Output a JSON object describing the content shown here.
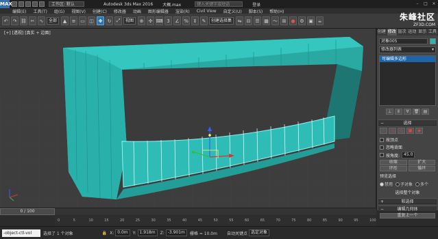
{
  "titlebar": {
    "logo": "MAX",
    "workspace": "工作区: 默认",
    "app_title": "Autodesk 3ds Max 2016",
    "file_name": "大概.max",
    "search_placeholder": "键入关键字或短语",
    "signin": "登录"
  },
  "menubar": [
    "编辑(E)",
    "工具(T)",
    "组(G)",
    "视图(V)",
    "创建(C)",
    "修改器",
    "动画",
    "图形编辑器",
    "渲染(R)",
    "Civil View",
    "自定义(U)",
    "脚本(S)",
    "帮助(H)"
  ],
  "toolbar": {
    "selection_filter": "全部",
    "reference_coord": "视图",
    "named_selection": "创建选择集"
  },
  "watermark": {
    "mark": "朱峰社区",
    "sub": "ZF3D.COM"
  },
  "viewport": {
    "label": "[+] [透视] [真实 + 边面]"
  },
  "command_panel": {
    "tabs": [
      "创建",
      "修改",
      "层次",
      "运动",
      "显示",
      "工具"
    ],
    "object_name": "对象005",
    "modifier_list": "修改器列表",
    "stack_item": "可编辑多边形",
    "selection_title": "选择",
    "checkbox_vertex": "按顶点",
    "checkbox_backface": "忽略背面",
    "checkbox_angle": "按角度:",
    "angle_value": "45.0",
    "shrink": "收缩",
    "grow": "扩大",
    "ring": "环形",
    "loop": "循环",
    "preview_label": "预览选择",
    "preview_off": "禁用",
    "preview_sub": "子对象",
    "preview_multi": "多个",
    "selection_info": "选择整个对象",
    "soft_selection": "软选择",
    "edit_geometry": "编辑几何体",
    "repeat_last": "重复上一个"
  },
  "timeline": {
    "frame": "0 / 100",
    "ticks": [
      "0",
      "5",
      "10",
      "15",
      "20",
      "25",
      "30",
      "35",
      "40",
      "45",
      "50",
      "55",
      "60",
      "65",
      "70",
      "75",
      "80",
      "85",
      "90",
      "95",
      "100"
    ]
  },
  "status": {
    "maxscript": "-object-ctl-vol",
    "selected": "选择了 1 个对象",
    "x_label": "X:",
    "x_val": "0.0m",
    "y_label": "Y:",
    "y_val": "1.918m",
    "z_label": "Z:",
    "z_val": "-3.901m",
    "grid": "栅格 = 10.0m",
    "autokey": "自动关键点",
    "selected_obj": "选定对象"
  },
  "colors": {
    "object": "#2bb5b0",
    "selection": "#8ef3ef",
    "accent": "#2f73b5"
  }
}
